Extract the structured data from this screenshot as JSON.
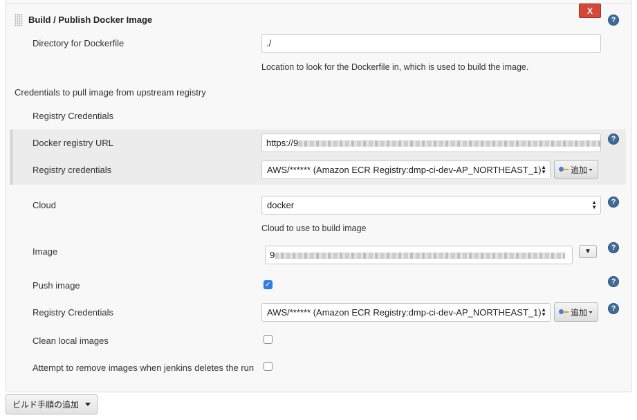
{
  "section": {
    "title": "Build / Publish Docker Image",
    "delete_label": "X"
  },
  "help_glyph": "?",
  "dockerfile": {
    "label": "Directory for Dockerfile",
    "value": "./",
    "description": "Location to look for the Dockerfile in, which is used to build the image."
  },
  "pull_credentials": {
    "heading": "Credentials to pull image from upstream registry",
    "subheading": "Registry Credentials",
    "registry_url_label": "Docker registry URL",
    "registry_url_value_prefix": "https://9",
    "registry_credentials_label": "Registry credentials",
    "registry_credentials_value": "AWS/****** (Amazon ECR Registry:dmp-ci-dev-AP_NORTHEAST_1)",
    "add_label": "追加"
  },
  "cloud": {
    "label": "Cloud",
    "value": "docker",
    "description": "Cloud to use to build image"
  },
  "image": {
    "label": "Image",
    "value_prefix": "9"
  },
  "push_image": {
    "label": "Push image",
    "checked": true
  },
  "push_credentials": {
    "label": "Registry Credentials",
    "value": "AWS/****** (Amazon ECR Registry:dmp-ci-dev-AP_NORTHEAST_1)",
    "add_label": "追加"
  },
  "clean_local": {
    "label": "Clean local images",
    "checked": false
  },
  "remove_on_delete": {
    "label": "Attempt to remove images when jenkins deletes the run",
    "checked": false
  },
  "footer": {
    "add_build_step_label": "ビルド手順の追加"
  },
  "colors": {
    "delete_button": "#d24939",
    "help_icon": "#3f6b9a",
    "checkbox_checked": "#2f7fe6",
    "panel_background": "#f8f8f8"
  }
}
